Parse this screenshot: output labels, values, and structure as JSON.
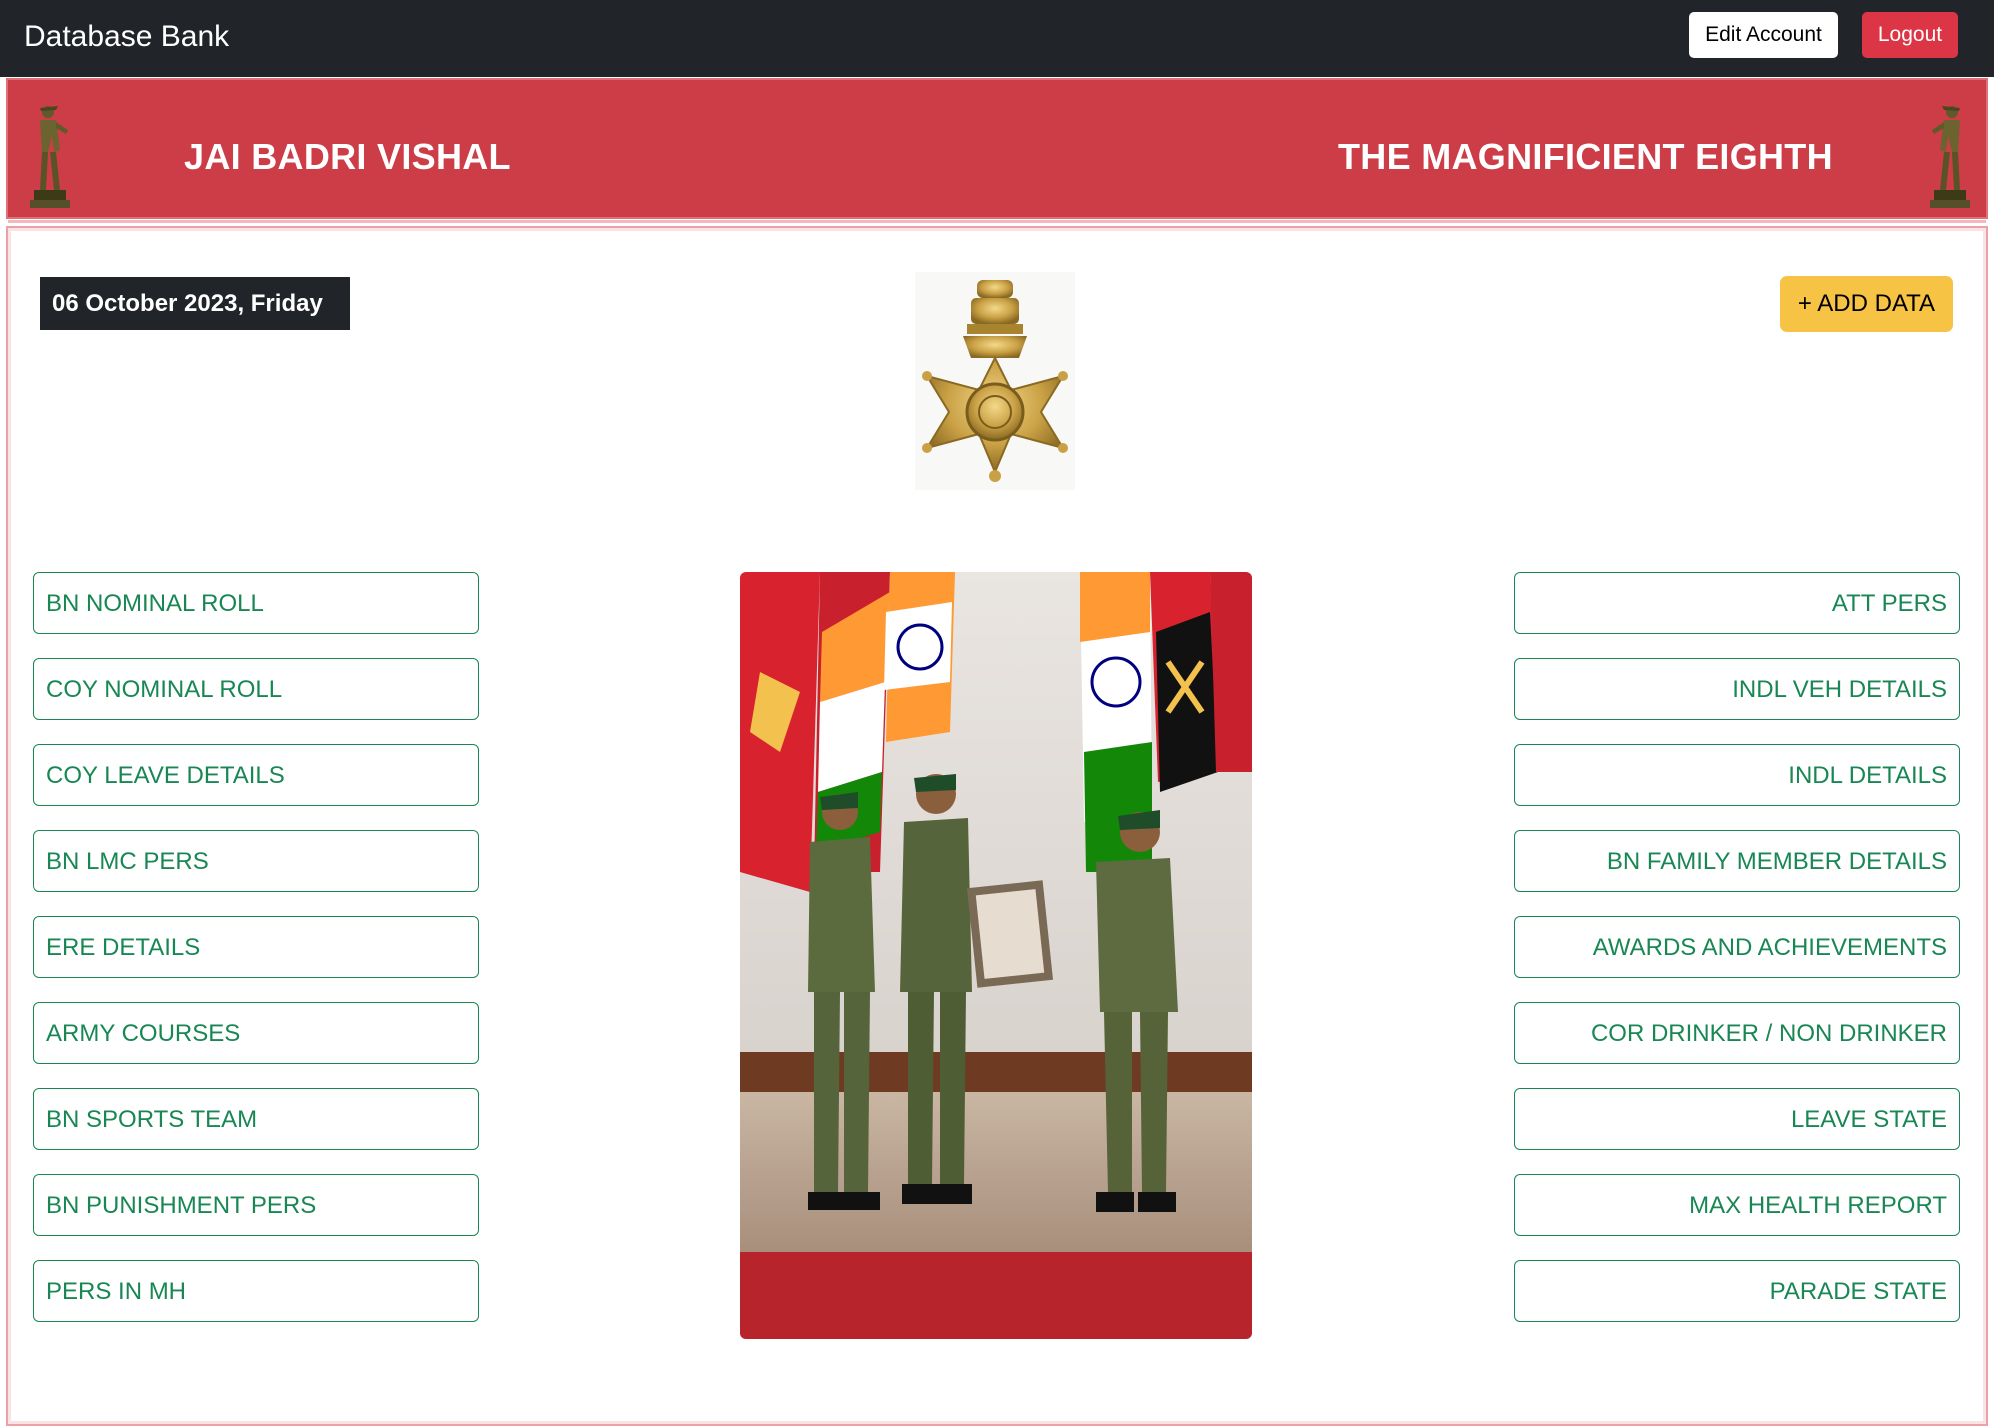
{
  "navbar": {
    "brand": "Database Bank",
    "edit_account_label": "Edit Account",
    "logout_label": "Logout"
  },
  "banner": {
    "motto_left": "JAI BADRI VISHAL",
    "motto_right": "THE MAGNIFICIENT EIGHTH"
  },
  "main": {
    "date": "06 October 2023, Friday",
    "add_data_label": "+ ADD DATA",
    "left_menu": [
      "BN NOMINAL ROLL",
      "COY NOMINAL ROLL",
      "COY LEAVE DETAILS",
      "BN LMC PERS",
      "ERE DETAILS",
      "ARMY COURSES",
      "BN SPORTS TEAM",
      "BN PUNISHMENT PERS",
      "PERS IN MH"
    ],
    "right_menu": [
      "ATT PERS",
      "INDL VEH DETAILS",
      "INDL DETAILS",
      "BN FAMILY MEMBER DETAILS",
      "AWARDS AND ACHIEVEMENTS",
      "COR DRINKER / NON DRINKER",
      "LEAVE STATE",
      "MAX HEALTH REPORT",
      "PARADE STATE"
    ]
  },
  "colors": {
    "navbar_bg": "#212529",
    "banner_red": "#cc3d47",
    "logout_red": "#dc3545",
    "add_yellow": "#f6c344",
    "menu_green": "#198754"
  },
  "icons": {
    "soldier": "soldier-statue-icon",
    "emblem": "regimental-insignia-icon"
  }
}
